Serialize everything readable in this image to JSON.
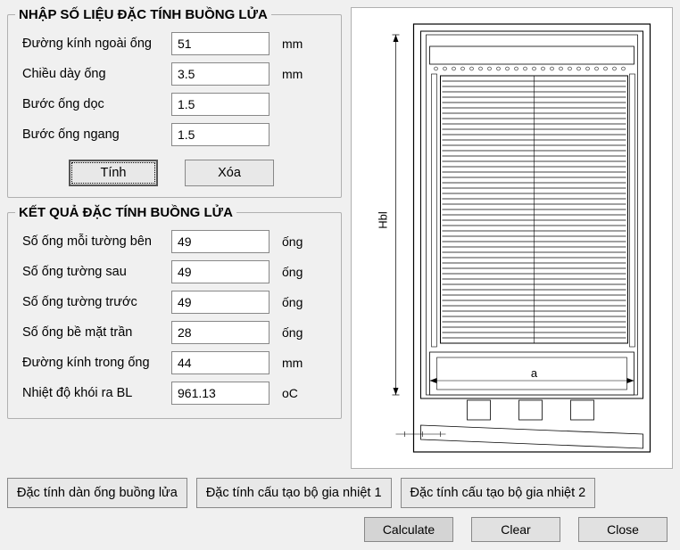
{
  "input_section": {
    "title": "NHẬP SỐ LIỆU ĐẶC TÍNH BUỒNG LỬA",
    "fields": [
      {
        "label": "Đường kính ngoài ống",
        "value": "51",
        "unit": "mm"
      },
      {
        "label": "Chiều dày ống",
        "value": "3.5",
        "unit": "mm"
      },
      {
        "label": "Bước ống dọc",
        "value": "1.5",
        "unit": ""
      },
      {
        "label": "Bước ống ngang",
        "value": "1.5",
        "unit": ""
      }
    ],
    "calc_button": "Tính",
    "clear_button": "Xóa"
  },
  "output_section": {
    "title": "KẾT QUẢ ĐẶC TÍNH BUỒNG LỬA",
    "fields": [
      {
        "label": "Số ống mỗi tường bên",
        "value": "49",
        "unit": "ống"
      },
      {
        "label": "Số ống tường sau",
        "value": "49",
        "unit": "ống"
      },
      {
        "label": "Số ống tường trước",
        "value": "49",
        "unit": "ống"
      },
      {
        "label": "Số ống bề mặt trần",
        "value": "28",
        "unit": "ống"
      },
      {
        "label": "Đường kính trong ống",
        "value": "44",
        "unit": "mm"
      },
      {
        "label": "Nhiệt độ khói ra BL",
        "value": "961.13",
        "unit": "oC"
      }
    ]
  },
  "diagram": {
    "label_h": "Hbl",
    "label_a": "a"
  },
  "tabs": [
    "Đặc tính dàn ống buồng lửa",
    "Đặc tính cấu tạo bộ gia nhiệt 1",
    "Đặc tính cấu tạo bộ gia nhiệt 2"
  ],
  "actions": {
    "calculate": "Calculate",
    "clear": "Clear",
    "close": "Close"
  }
}
